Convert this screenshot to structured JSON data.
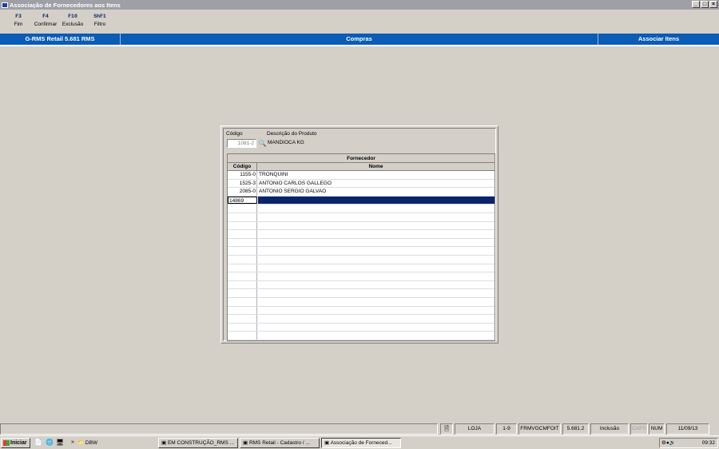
{
  "window": {
    "title": "Associação de Fornecedores aos Itens"
  },
  "fkeys": [
    {
      "key": "F3",
      "label": "Fim"
    },
    {
      "key": "F4",
      "label": "Confirmar"
    },
    {
      "key": "F10",
      "label": "Exclusão"
    },
    {
      "key": "ShF1",
      "label": "Filtro"
    }
  ],
  "header": {
    "left": "G-RMS Retail 5.681 RMS",
    "center": "Compras",
    "right": "Associar Itens"
  },
  "form": {
    "codigo_label": "Código",
    "descricao_label": "Descrição do Produto",
    "codigo_value": "1081-2",
    "descricao_value": "MANDIOCA KG"
  },
  "grid": {
    "group_header": "Fornecedor",
    "col_codigo": "Código",
    "col_nome": "Nome",
    "rows": [
      {
        "codigo": "1155-0",
        "nome": "TRONQUINI"
      },
      {
        "codigo": "1525-3",
        "nome": "ANTONIO CARLOS GALLEGO"
      },
      {
        "codigo": "2085-0",
        "nome": "ANTONIO SERGIO GALVAO"
      }
    ],
    "edit_value": "14869"
  },
  "statusbar": {
    "loja": "LOJA",
    "range": "1-9",
    "form": "FRMVGCMFOIT",
    "version": "5.681.2",
    "mode": "Inclusão",
    "caps": "CAPS",
    "num": "NUM",
    "date": "11/09/13"
  },
  "taskbar": {
    "start": "Iniciar",
    "folder": "DBW",
    "items": [
      "EM CONSTRUÇÃO_RMS ...",
      "RMS Retail - Cadastro / ...",
      "Associação de Forneced..."
    ],
    "time": "09:32"
  }
}
